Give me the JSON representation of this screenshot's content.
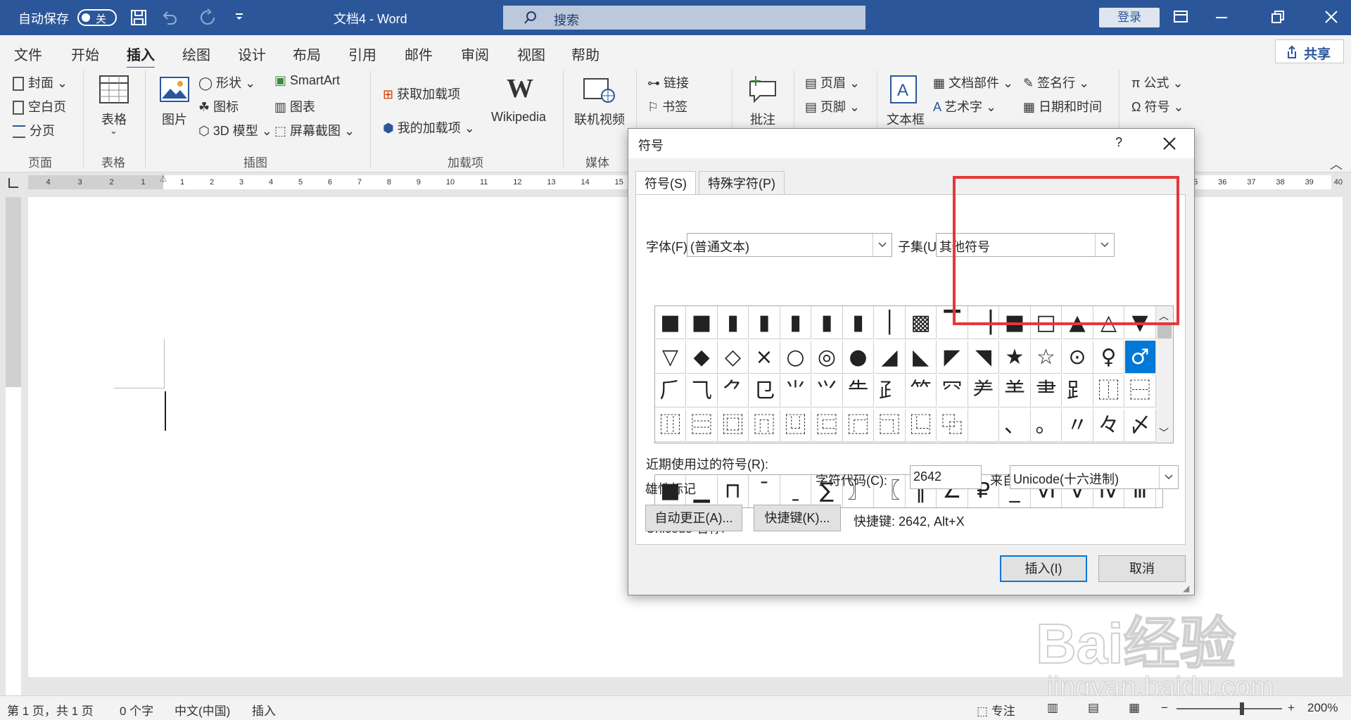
{
  "titlebar": {
    "autosave_label": "自动保存",
    "autosave_state": "关",
    "doc_title": "文档4  -  Word",
    "search_label": "搜索",
    "login_label": "登录"
  },
  "ribbon_tabs": [
    "文件",
    "开始",
    "插入",
    "绘图",
    "设计",
    "布局",
    "引用",
    "邮件",
    "审阅",
    "视图",
    "帮助"
  ],
  "active_tab": "插入",
  "share_label": "共享",
  "ribbon": {
    "pages": [
      "封面",
      "空白页",
      "分页"
    ],
    "table": "表格",
    "picture": "图片",
    "illus": [
      "形状",
      "图标",
      "3D 模型"
    ],
    "illus2": [
      "SmartArt",
      "图表",
      "屏幕截图"
    ],
    "addins": [
      "获取加载项",
      "我的加载项"
    ],
    "wikipedia": "Wikipedia",
    "video": "联机视频",
    "links": [
      "链接",
      "书签"
    ],
    "comment": "批注",
    "headerfooter": [
      "页眉",
      "页脚"
    ],
    "textbox": "文本框",
    "text": [
      "文档部件",
      "艺术字"
    ],
    "text2": [
      "签名行",
      "日期和时间"
    ],
    "symbols": [
      "公式",
      "符号"
    ],
    "groups": [
      "页面",
      "表格",
      "插图",
      "加载项",
      "媒体"
    ]
  },
  "ruler": {
    "left_numbers": [
      "4",
      "3",
      "2",
      "1"
    ],
    "right_numbers": [
      "1",
      "2",
      "3",
      "4",
      "5",
      "6",
      "7",
      "8",
      "9",
      "10",
      "11",
      "12",
      "13",
      "14",
      "15"
    ],
    "far_right": [
      "35",
      "36",
      "37",
      "38",
      "39",
      "40"
    ]
  },
  "dialog": {
    "title": "符号",
    "help": "?",
    "tabs": [
      "符号(S)",
      "特殊字符(P)"
    ],
    "font_label": "字体(F):",
    "font_value": "(普通文本)",
    "subset_label": "子集(U):",
    "subset_value": "其他符号",
    "grid_rows": [
      [
        "■",
        "■",
        "▮",
        "▮",
        "▮",
        "▮",
        "▮",
        "│",
        "▩",
        "▔",
        "▕",
        "■",
        "□",
        "▲",
        "△",
        "▼"
      ],
      [
        "▽",
        "◆",
        "◇",
        "×",
        "○",
        "◎",
        "●",
        "◢",
        "◣",
        "◤",
        "◥",
        "★",
        "☆",
        "⊙",
        "♀",
        "♂"
      ],
      [
        "⺁",
        "⺄",
        "⺈",
        "⺋",
        "⺌",
        "⺍",
        "⺧",
        "⺪",
        "⺮",
        "⺳",
        "⺶",
        "⺷",
        "⺻",
        "⻊",
        "⿰",
        "⿱"
      ],
      [
        "⿲",
        "⿳",
        "⿴",
        "⿵",
        "⿶",
        "⿷",
        "⿸",
        "⿹",
        "⿺",
        "⿻",
        "　",
        "、",
        "。",
        "〃",
        "々",
        "〆"
      ]
    ],
    "selected_symbol": "♂",
    "recent_label": "近期使用过的符号(R):",
    "recent": [
      "■",
      "▁",
      "⊓",
      "ˉ",
      "ˍ",
      "∑",
      "〗",
      "〖",
      "‖",
      "∠",
      "₽",
      "_",
      "Ⅵ",
      "Ⅴ",
      "Ⅳ",
      "Ⅲ"
    ],
    "unicode_name_label": "Unicode 名称:",
    "unicode_name_value": "雄性标记",
    "charcode_label": "字符代码(C):",
    "charcode_value": "2642",
    "from_label": "来自(M):",
    "from_value": "Unicode(十六进制)",
    "autocorrect_btn": "自动更正(A)...",
    "shortcut_btn": "快捷键(K)...",
    "shortcut_text": "快捷键: 2642, Alt+X",
    "insert_btn": "插入(I)",
    "cancel_btn": "取消"
  },
  "status": {
    "page": "第 1 页，共 1 页",
    "words": "0 个字",
    "lang": "中文(中国)",
    "mode": "插入",
    "focus": "专注",
    "zoom": "200%"
  },
  "watermark": {
    "brand": "Bai经验",
    "url": "jingyan.baidu.com"
  }
}
